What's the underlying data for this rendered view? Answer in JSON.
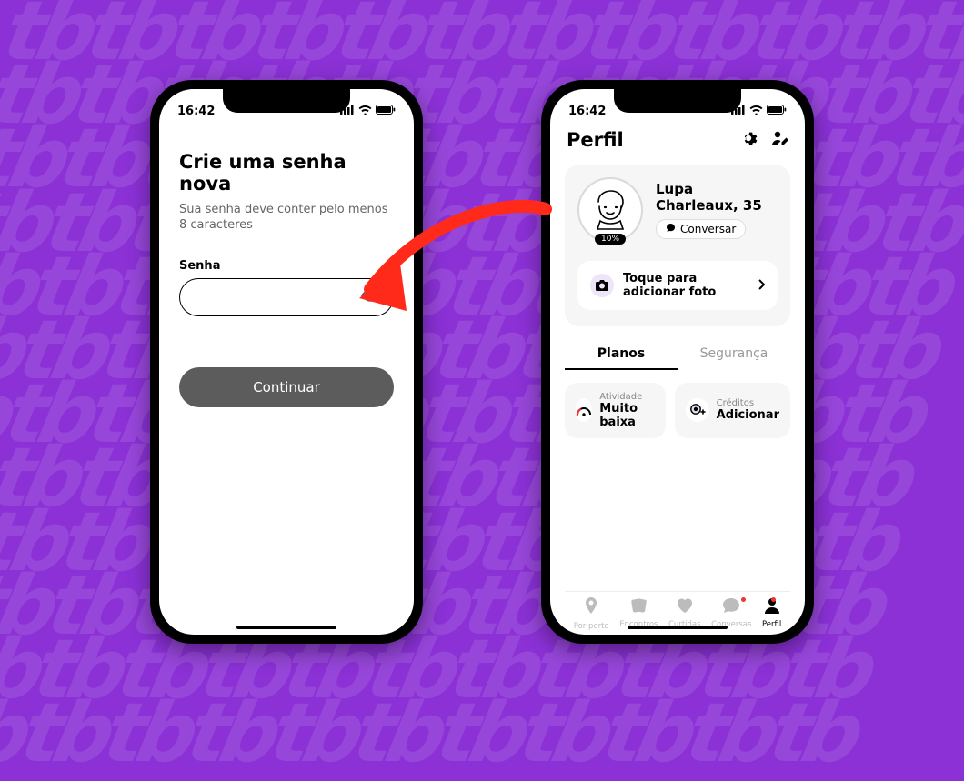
{
  "status": {
    "time": "16:42"
  },
  "screen1": {
    "title": "Crie uma senha nova",
    "subtitle": "Sua senha deve conter pelo menos 8 caracteres",
    "field_label": "Senha",
    "button": "Continuar"
  },
  "screen2": {
    "title": "Perfil",
    "user": {
      "name_age": "Lupa Charleaux, 35",
      "chat": "Conversar",
      "completion": "10%"
    },
    "add_photo": "Toque para adicionar foto",
    "tabs": {
      "plans": "Planos",
      "security": "Segurança"
    },
    "plan_cards": {
      "activity": {
        "label": "Atividade",
        "value": "Muito baixa"
      },
      "credits": {
        "label": "Créditos",
        "value": "Adicionar"
      }
    },
    "nav": {
      "nearby": "Por perto",
      "encounters": "Encontros",
      "liked": "Curtidas",
      "chats": "Conversas",
      "profile": "Perfil"
    }
  }
}
